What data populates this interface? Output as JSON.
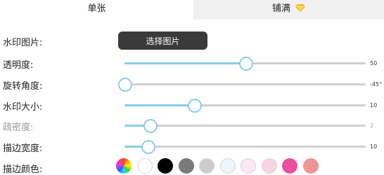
{
  "tabs": {
    "single": "单张",
    "tile": "铺满",
    "tile_badge_icon": "diamond-icon",
    "tile_badge_color": "#f5c518"
  },
  "rows": {
    "watermark_image": {
      "label": "水印图片:",
      "button_label": "选择图片"
    },
    "opacity": {
      "label": "透明度:",
      "value_text": "50",
      "fraction": 0.5
    },
    "rotation": {
      "label": "旋转角度:",
      "value_text": "-45°",
      "fraction": 0.0
    },
    "size": {
      "label": "水印大小:",
      "value_text": "10",
      "fraction": 0.29
    },
    "density": {
      "label": "疏密度:",
      "value_text": "2",
      "fraction": 0.105,
      "disabled": true
    },
    "border_width": {
      "label": "描边宽度:",
      "value_text": "10",
      "fraction": 0.097
    },
    "border_color": {
      "label": "描边颜色:",
      "swatches": [
        "color-picker",
        "#ffffff",
        "#000000",
        "#7a7a7a",
        "#cccccc",
        "#eef6fc",
        "#fbe8f4",
        "#f8d3e3",
        "#ec4d9e",
        "#ee9696"
      ]
    }
  },
  "colors": {
    "slider_fill": "#8ccde8",
    "slider_track": "#cfcfcf",
    "button_bg": "#3a3a3a"
  }
}
